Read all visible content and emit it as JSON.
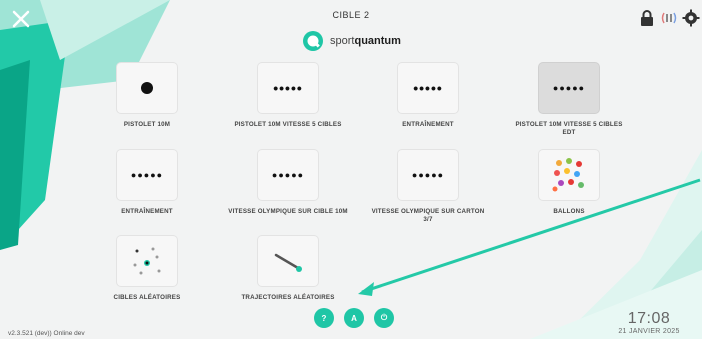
{
  "header": {
    "title": "CIBLE 2",
    "brand_prefix": "sport",
    "brand_bold": "quantum"
  },
  "tiles": [
    {
      "label": "PISTOLET 10M",
      "thumb": "single-dot"
    },
    {
      "label": "PISTOLET 10M VITESSE 5 CIBLES",
      "thumb": "five-dots-small"
    },
    {
      "label": "ENTRAÎNEMENT",
      "thumb": "five-dots-small"
    },
    {
      "label": "PISTOLET 10M VITESSE 5 CIBLES EDT",
      "thumb": "five-dots-bold"
    },
    {
      "label": "ENTRAÎNEMENT",
      "thumb": "five-dots-bold"
    },
    {
      "label": "VITESSE OLYMPIQUE SUR CIBLE 10M",
      "thumb": "five-dots-bold"
    },
    {
      "label": "VITESSE OLYMPIQUE SUR CARTON 3/7",
      "thumb": "five-dots-bold"
    },
    {
      "label": "BALLONS",
      "thumb": "balloons"
    },
    {
      "label": "CIBLES ALÉATOIRES",
      "thumb": "random-targets"
    },
    {
      "label": "TRAJECTOIRES ALÉATOIRES",
      "thumb": "trajectory"
    }
  ],
  "dots": {
    "five_small": "•••••",
    "five_bold": "●●●●●"
  },
  "bottom": {
    "help": "?",
    "translate": "A",
    "power": "⏻"
  },
  "status": {
    "version": "v2.3.521 (dev)) Online dev",
    "time": "17:08",
    "date": "21 JANVIER 2025"
  },
  "colors": {
    "accent": "#1fc6a6",
    "accent_dark": "#0a9f86"
  }
}
